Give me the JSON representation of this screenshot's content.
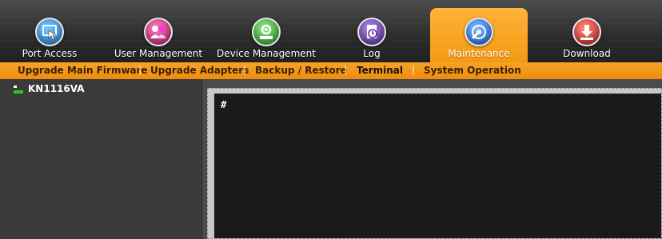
{
  "nav": {
    "tabs": [
      {
        "label": "Port Access",
        "icon": "port-access-icon",
        "color": "#2f8fd6",
        "active": false
      },
      {
        "label": "User Management",
        "icon": "user-management-icon",
        "color": "#b52a7a",
        "active": false
      },
      {
        "label": "Device Management",
        "icon": "device-management-icon",
        "color": "#3aa83a",
        "active": false
      },
      {
        "label": "Log",
        "icon": "log-icon",
        "color": "#6a3fa8",
        "active": false
      },
      {
        "label": "Maintenance",
        "icon": "maintenance-icon",
        "color": "#2a6fd0",
        "active": true
      },
      {
        "label": "Download",
        "icon": "download-icon",
        "color": "#d23a3a",
        "active": false
      }
    ]
  },
  "subnav": {
    "items": [
      {
        "label": "Upgrade Main Firmware",
        "active": false
      },
      {
        "label": "Upgrade Adapters",
        "active": false
      },
      {
        "label": "Backup / Restore",
        "active": false
      },
      {
        "label": "Terminal",
        "active": true
      },
      {
        "label": "System Operation",
        "active": false
      }
    ],
    "separator": "|"
  },
  "sidebar": {
    "device": {
      "name": "KN1116VA",
      "icon": "device-icon"
    }
  },
  "terminal": {
    "prompt": "#"
  },
  "colors": {
    "accent": "#f39a12",
    "terminal_bg": "#1a1a1a",
    "sidebar_bg": "#3a3a3a"
  }
}
